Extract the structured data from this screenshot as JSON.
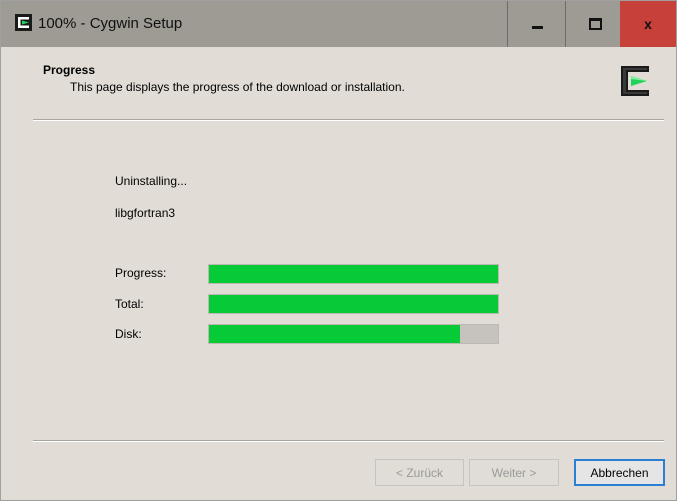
{
  "window": {
    "title": "100% - Cygwin Setup",
    "controls": {
      "minimize": "minimize",
      "maximize": "maximize",
      "close": "x"
    }
  },
  "header": {
    "title": "Progress",
    "subtitle": "This page displays the progress of the download or installation."
  },
  "status": {
    "action": "Uninstalling...",
    "package": "libgfortran3"
  },
  "progress": [
    {
      "label": "Progress:",
      "fraction": 1.0
    },
    {
      "label": "Total:",
      "fraction": 1.0
    },
    {
      "label": "Disk:",
      "fraction": 0.87
    }
  ],
  "buttons": {
    "back": "< Zurück",
    "next": "Weiter >",
    "cancel": "Abbrechen"
  },
  "colors": {
    "progress_fill": "#06cb36",
    "progress_track": "#c6c3be",
    "close_button": "#c8403a",
    "logo_green": "#1fd35a"
  },
  "icons": {
    "app": "cygwin-logo-icon",
    "header_logo": "cygwin-logo-icon"
  }
}
